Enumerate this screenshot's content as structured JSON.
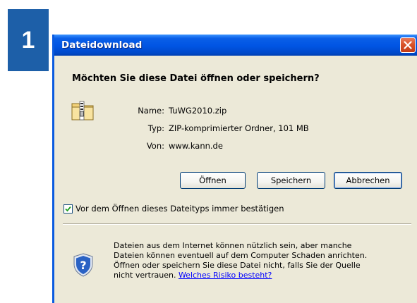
{
  "step_number": "1",
  "dialog": {
    "title": "Dateidownload",
    "question": "Möchten Sie diese Datei öffnen oder speichern?",
    "file_info": {
      "name_label": "Name:",
      "name_value": "TuWG2010.zip",
      "type_label": "Typ:",
      "type_value": "ZIP-komprimierter Ordner, 101 MB",
      "from_label": "Von:",
      "from_value": "www.kann.de"
    },
    "buttons": {
      "open": "Öffnen",
      "save": "Speichern",
      "cancel": "Abbrechen"
    },
    "checkbox": {
      "label": "Vor dem Öffnen dieses Dateityps immer bestätigen",
      "checked": true
    },
    "warning": {
      "line1": "Dateien aus dem Internet können nützlich sein, aber manche",
      "line2": "Dateien können eventuell auf dem Computer Schaden anrichten.",
      "line3": "Öffnen oder speichern Sie diese Datei nicht, falls Sie der Quelle",
      "line4_prefix": "nicht vertrauen.",
      "link": "Welches Risiko besteht?"
    },
    "icons": {
      "file": "zip-folder-icon",
      "shield": "security-shield-icon",
      "close": "close-icon"
    }
  },
  "colors": {
    "badge": "#1d5fa8",
    "titlebar": "#0054e3",
    "dialog_background": "#ece9d8",
    "close_button": "#d9532a",
    "link": "#0000ff"
  }
}
